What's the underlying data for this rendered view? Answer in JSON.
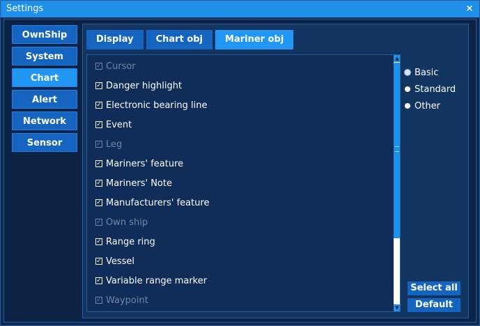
{
  "window": {
    "title": "Settings",
    "close_label": "×"
  },
  "nav": {
    "items": [
      {
        "label": "OwnShip"
      },
      {
        "label": "System"
      },
      {
        "label": "Chart",
        "active": true
      },
      {
        "label": "Alert"
      },
      {
        "label": "Network"
      },
      {
        "label": "Sensor"
      }
    ]
  },
  "tabs": [
    {
      "label": "Display"
    },
    {
      "label": "Chart obj"
    },
    {
      "label": "Mariner obj",
      "active": true
    }
  ],
  "objects": [
    {
      "label": "Cursor",
      "checked": true,
      "enabled": false
    },
    {
      "label": "Danger highlight",
      "checked": true,
      "enabled": true
    },
    {
      "label": "Electronic bearing line",
      "checked": true,
      "enabled": true
    },
    {
      "label": "Event",
      "checked": true,
      "enabled": true
    },
    {
      "label": "Leg",
      "checked": true,
      "enabled": false
    },
    {
      "label": "Mariners' feature",
      "checked": true,
      "enabled": true
    },
    {
      "label": "Mariners' Note",
      "checked": true,
      "enabled": true
    },
    {
      "label": "Manufacturers' feature",
      "checked": true,
      "enabled": true
    },
    {
      "label": "Own ship",
      "checked": true,
      "enabled": false
    },
    {
      "label": "Range ring",
      "checked": true,
      "enabled": true
    },
    {
      "label": "Vessel",
      "checked": true,
      "enabled": true
    },
    {
      "label": "Variable range marker",
      "checked": true,
      "enabled": true
    },
    {
      "label": "Waypoint",
      "checked": true,
      "enabled": false
    }
  ],
  "display_modes": [
    {
      "label": "Basic",
      "checked": true
    },
    {
      "label": "Standard",
      "checked": false
    },
    {
      "label": "Other",
      "checked": false
    }
  ],
  "buttons": {
    "select_all": "Select all",
    "default": "Default"
  },
  "colors": {
    "title_bar": "#1e90e8",
    "button": "#1565c0",
    "button_active": "#2196f3",
    "background": "#0d2346",
    "disabled_text": "#6f86a6"
  }
}
